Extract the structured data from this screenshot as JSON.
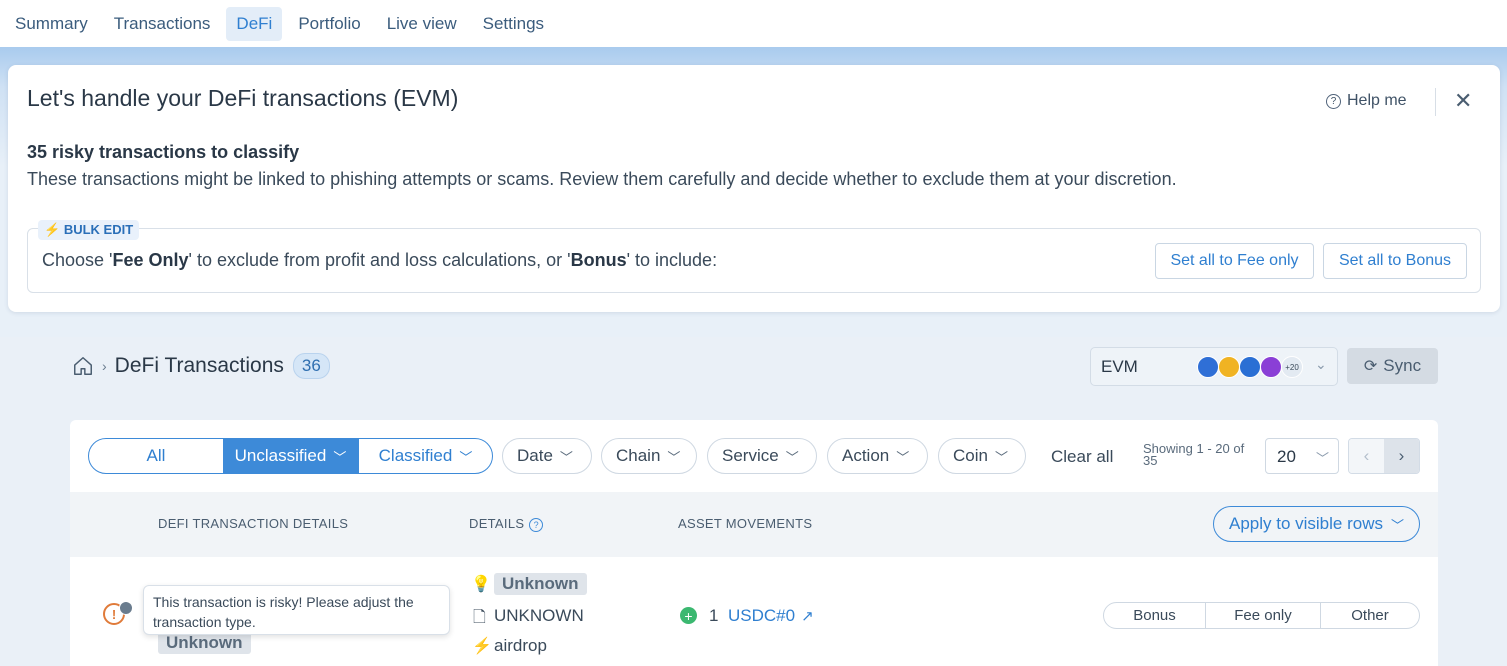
{
  "nav": {
    "tabs": [
      {
        "label": "Summary"
      },
      {
        "label": "Transactions"
      },
      {
        "label": "DeFi"
      },
      {
        "label": "Portfolio"
      },
      {
        "label": "Live view"
      },
      {
        "label": "Settings"
      }
    ],
    "active": "DeFi"
  },
  "banner": {
    "title": "Let's handle your DeFi transactions (EVM)",
    "help_label": "Help me",
    "risk_title": "35 risky transactions to classify",
    "risk_desc": "These transactions might be linked to phishing attempts or scams. Review them carefully and decide whether to exclude them at your discretion.",
    "bulk_tag": "BULK EDIT",
    "bulk_text_1": "Choose '",
    "bulk_fee": "Fee Only",
    "bulk_text_2": "' to exclude from profit and loss calculations, or '",
    "bulk_bonus": "Bonus",
    "bulk_text_3": "' to include:",
    "set_fee_label": "Set all to Fee only",
    "set_bonus_label": "Set all to Bonus"
  },
  "header": {
    "title": "DeFi Transactions",
    "count": "36",
    "chain_select": "EVM",
    "more_chains": "+20",
    "sync_label": "Sync"
  },
  "filters": {
    "segments": [
      "All",
      "Unclassified",
      "Classified"
    ],
    "pills": [
      "Date",
      "Chain",
      "Service",
      "Action",
      "Coin"
    ],
    "clear_label": "Clear all",
    "showing": "Showing 1 - 20 of 35",
    "page_size": "20"
  },
  "table": {
    "columns": [
      "DEFI TRANSACTION DETAILS",
      "DETAILS",
      "ASSET MOVEMENTS"
    ],
    "apply_label": "Apply to visible rows",
    "row": {
      "tooltip": "This transaction is risky! Please adjust the transaction type.",
      "status_tag": "Unknown",
      "detail_tag": "Unknown",
      "detail_type": "UNKNOWN",
      "detail_action": "airdrop",
      "amount": "1",
      "asset": "USDC#0",
      "choices": [
        "Bonus",
        "Fee only",
        "Other"
      ]
    }
  },
  "colors": {
    "accent": "#3d8ad8",
    "warning": "#e07b3a",
    "positive": "#3bb870"
  }
}
